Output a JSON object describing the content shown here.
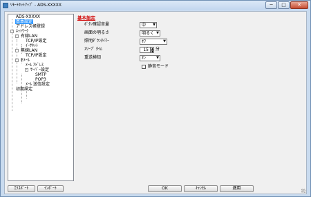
{
  "window": {
    "title": "ﾘﾓｰﾄｾｯﾄｱｯﾌﾟ - ADS-XXXXX",
    "controls": [
      "─",
      "□",
      "✕"
    ]
  },
  "tree": {
    "items": [
      {
        "label": "ADS-XXXXX",
        "toggle": "-",
        "selected": false
      },
      {
        "label": "基本設定",
        "toggle": "",
        "selected": true
      },
      {
        "label": "アドレス帳登録",
        "toggle": "",
        "selected": false
      },
      {
        "label": "ﾈｯﾄﾜｰｸ",
        "toggle": "-",
        "selected": false
      },
      {
        "label": "有線LAN",
        "toggle": "-",
        "selected": false
      },
      {
        "label": "TCP/IP設定",
        "toggle": "",
        "selected": false
      },
      {
        "label": "ｲｰｻﾈｯﾄ",
        "toggle": "",
        "selected": false
      },
      {
        "label": "無線LAN",
        "toggle": "-",
        "selected": false
      },
      {
        "label": "TCP/IP設定",
        "toggle": "",
        "selected": false
      },
      {
        "label": "Eﾒｰﾙ",
        "toggle": "-",
        "selected": false
      },
      {
        "label": "ﾒｰﾙ ｱﾄﾞﾚｽ",
        "toggle": "",
        "selected": false
      },
      {
        "label": "ｻｰﾊﾞｰ設定",
        "toggle": "-",
        "selected": false
      },
      {
        "label": "SMTP",
        "toggle": "",
        "selected": false
      },
      {
        "label": "POP3",
        "toggle": "",
        "selected": false
      },
      {
        "label": "ﾒｰﾙ 送信設定",
        "toggle": "",
        "selected": false
      },
      {
        "label": "初期設定",
        "toggle": "",
        "selected": false
      }
    ]
  },
  "panel": {
    "title": "基本設定",
    "button_volume": {
      "label": "ﾎﾞﾀﾝ確認音量",
      "value": "中"
    },
    "brightness": {
      "label": "画面の明るさ",
      "value": "明るく"
    },
    "dim_timer": {
      "label": "照明ﾀﾞｳﾝﾀｲﾏｰ",
      "value": "ｵﾌ"
    },
    "sleep_time": {
      "label": "ｽﾘｰﾌﾟ ﾀｲﾑ",
      "value": "15",
      "unit": "分"
    },
    "multifeed": {
      "label": "重送検知",
      "value": "ｵﾝ"
    },
    "quiet_mode": {
      "label": "静音モード",
      "checked": false
    }
  },
  "footer": {
    "export": "ｴｸｽﾎﾟｰﾄ",
    "import": "ｲﾝﾎﾟｰﾄ",
    "ok": "OK",
    "cancel": "ｷｬﾝｾﾙ",
    "apply": "適用"
  }
}
